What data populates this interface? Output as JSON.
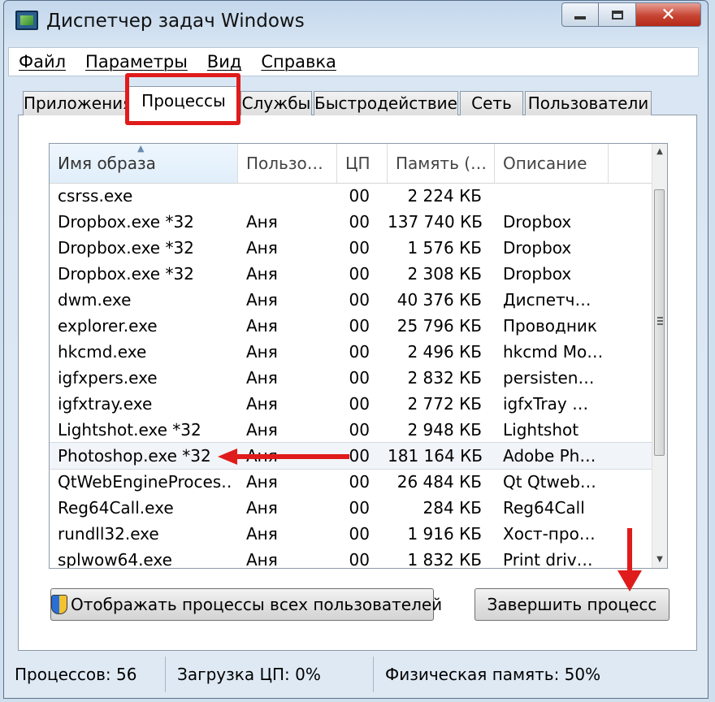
{
  "window": {
    "title": "Диспетчер задач Windows"
  },
  "menu": [
    "Файл",
    "Параметры",
    "Вид",
    "Справка"
  ],
  "tabs": [
    "Приложения",
    "Процессы",
    "Службы",
    "Быстродействие",
    "Сеть",
    "Пользователи"
  ],
  "active_tab": "Процессы",
  "columns": [
    "Имя образа",
    "Пользо…",
    "ЦП",
    "Память (…",
    "Описание"
  ],
  "rows": [
    {
      "name": "csrss.exe",
      "user": "",
      "cpu": "00",
      "mem": "2 224 КБ",
      "desc": ""
    },
    {
      "name": "Dropbox.exe *32",
      "user": "Аня",
      "cpu": "00",
      "mem": "137 740 КБ",
      "desc": "Dropbox"
    },
    {
      "name": "Dropbox.exe *32",
      "user": "Аня",
      "cpu": "00",
      "mem": "1 576 КБ",
      "desc": "Dropbox"
    },
    {
      "name": "Dropbox.exe *32",
      "user": "Аня",
      "cpu": "00",
      "mem": "2 308 КБ",
      "desc": "Dropbox"
    },
    {
      "name": "dwm.exe",
      "user": "Аня",
      "cpu": "00",
      "mem": "40 376 КБ",
      "desc": "Диспетч…"
    },
    {
      "name": "explorer.exe",
      "user": "Аня",
      "cpu": "00",
      "mem": "25 796 КБ",
      "desc": "Проводник"
    },
    {
      "name": "hkcmd.exe",
      "user": "Аня",
      "cpu": "00",
      "mem": "2 496 КБ",
      "desc": "hkcmd Mo…"
    },
    {
      "name": "igfxpers.exe",
      "user": "Аня",
      "cpu": "00",
      "mem": "2 832 КБ",
      "desc": "persisten…"
    },
    {
      "name": "igfxtray.exe",
      "user": "Аня",
      "cpu": "00",
      "mem": "2 772 КБ",
      "desc": "igfxTray …"
    },
    {
      "name": "Lightshot.exe *32",
      "user": "Аня",
      "cpu": "00",
      "mem": "2 948 КБ",
      "desc": "Lightshot"
    },
    {
      "name": "Photoshop.exe *32",
      "user": "Аня",
      "cpu": "00",
      "mem": "181 164 КБ",
      "desc": "Adobe Ph…"
    },
    {
      "name": "QtWebEngineProces…",
      "user": "Аня",
      "cpu": "00",
      "mem": "26 484 КБ",
      "desc": "Qt Qtweb…"
    },
    {
      "name": "Reg64Call.exe",
      "user": "Аня",
      "cpu": "00",
      "mem": "284 КБ",
      "desc": "Reg64Call"
    },
    {
      "name": "rundll32.exe",
      "user": "Аня",
      "cpu": "00",
      "mem": "1 916 КБ",
      "desc": "Хост-про…"
    },
    {
      "name": "splwow64.exe",
      "user": "Аня",
      "cpu": "00",
      "mem": "1 832 КБ",
      "desc": "Print driv…"
    }
  ],
  "buttons": {
    "show_all": "Отображать процессы всех пользователей",
    "end_process": "Завершить процесс"
  },
  "status": {
    "processes": "Процессов: 56",
    "cpu": "Загрузка ЦП: 0%",
    "memory": "Физическая память: 50%"
  },
  "colors": {
    "highlight_annotation": "#e01b1b"
  }
}
